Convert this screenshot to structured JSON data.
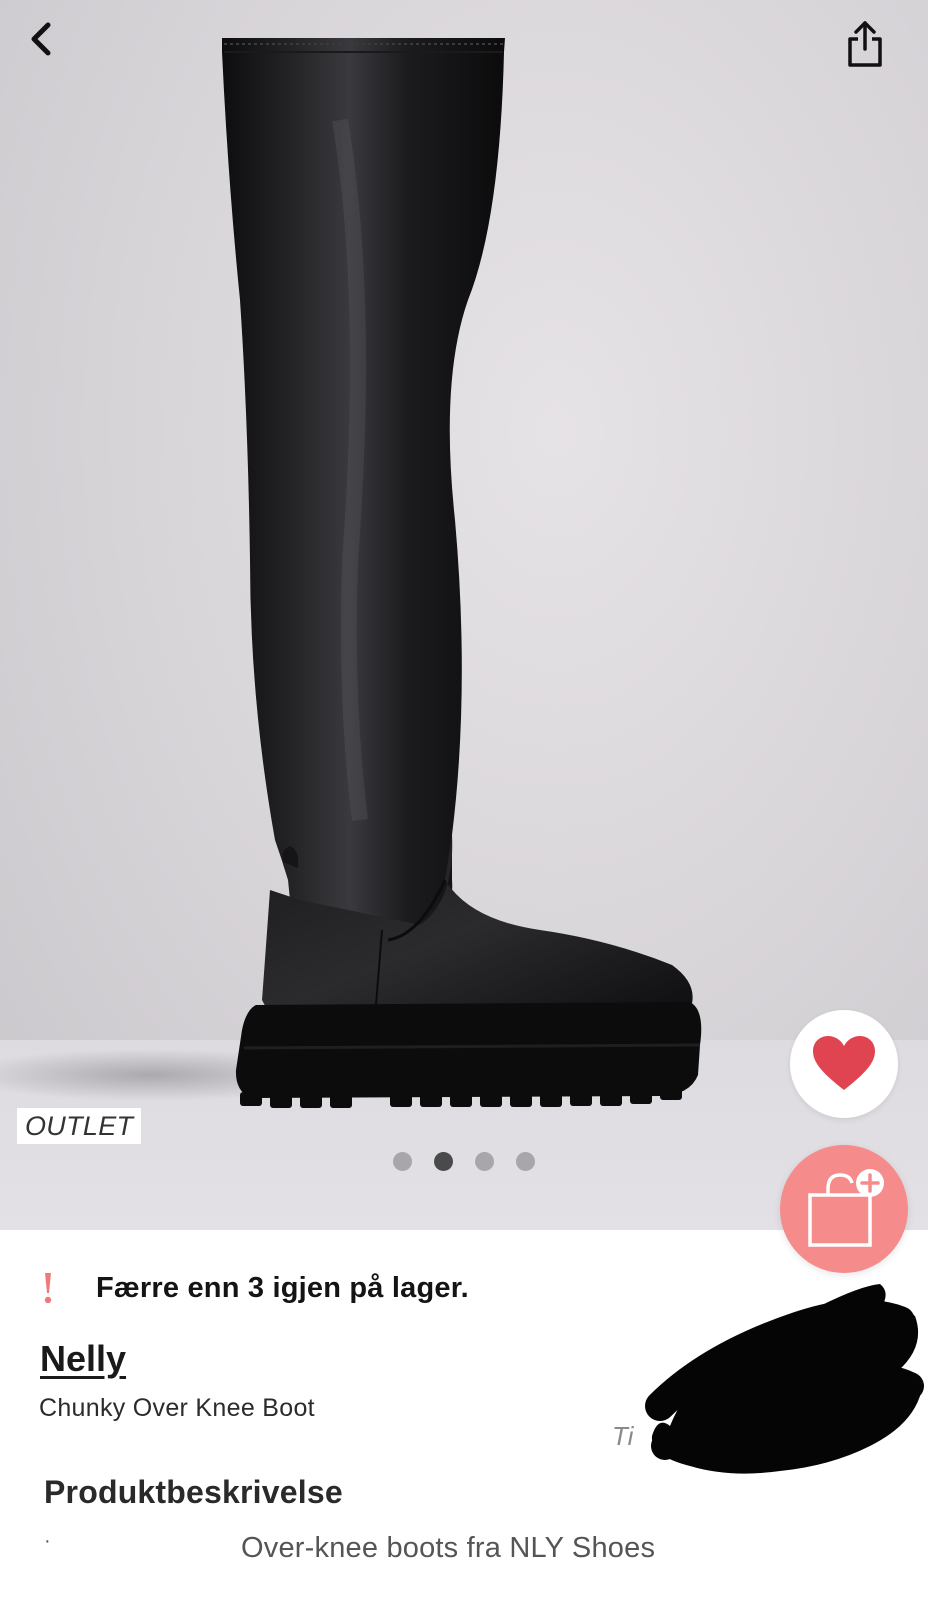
{
  "header": {
    "back_icon": "chevron-left-icon",
    "share_icon": "share-icon"
  },
  "gallery": {
    "badge": "OUTLET",
    "image_count": 4,
    "active_index": 1
  },
  "actions": {
    "favorite_icon": "heart-icon",
    "favorite_color": "#e04450",
    "add_to_bag_icon": "bag-plus-icon",
    "add_to_bag_color": "#f58b8b"
  },
  "product": {
    "stock_notice": "Færre enn 3 igjen på lager.",
    "stock_icon": "exclamation-icon",
    "stock_icon_color": "#f07a7a",
    "brand": "Nelly",
    "name": "Chunky Over Knee Boot",
    "obscured_text": "Ti"
  },
  "description": {
    "title": "Produktbeskrivelse",
    "bullets": [
      "Over-knee boots fra NLY Shoes"
    ]
  }
}
